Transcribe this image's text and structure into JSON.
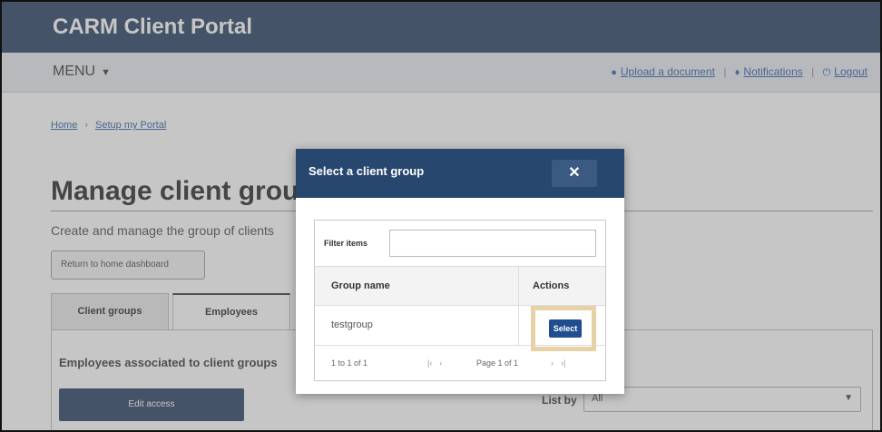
{
  "header": {
    "app_title": "CARM Client Portal",
    "menu_label": "MENU",
    "upload_label": "Upload a document",
    "notifications_label": "Notifications",
    "logout_label": "Logout"
  },
  "breadcrumb": {
    "home": "Home",
    "current": "Setup my Portal"
  },
  "page": {
    "title": "Manage client groups",
    "intro": "Create and manage the group of clients",
    "return_button": "Return to home dashboard",
    "tabs": [
      {
        "label": "Client groups"
      },
      {
        "label": "Employees"
      }
    ],
    "panel_heading": "Employees associated to client groups",
    "edit_button": "Edit access",
    "list_by_label": "List by",
    "list_by_value": "All"
  },
  "modal": {
    "title": "Select a client group",
    "close_glyph": "✕",
    "filter_label": "Filter items",
    "filter_value": "",
    "columns": {
      "group_name": "Group name",
      "actions": "Actions"
    },
    "rows": [
      {
        "group_name": "testgroup",
        "action_label": "Select"
      }
    ],
    "pager": {
      "count": "1 to 1 of 1",
      "first": "|‹",
      "prev": "‹",
      "page_info": "Page 1 of 1",
      "next": "›",
      "last": "›|"
    }
  },
  "colors": {
    "header_bg": "#1f3a5c",
    "modal_header_bg": "#28476e",
    "select_button": "#1f4d8f",
    "highlight": "#e6d2a6"
  }
}
